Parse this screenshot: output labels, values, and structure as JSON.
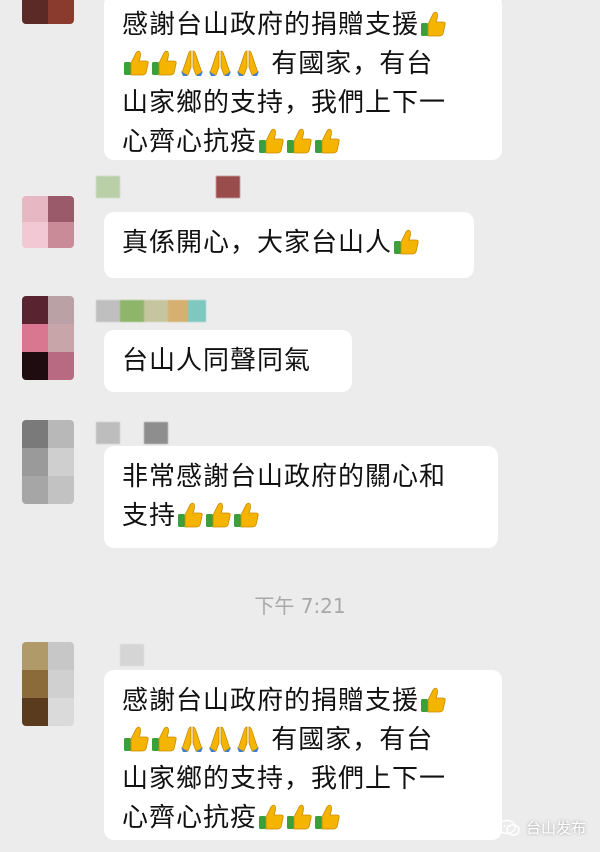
{
  "messages": [
    {
      "id": "m1",
      "text_lines": [
        "感謝台山政府的捐贈支援",
        "👍",
        "👍👍🙏🙏🙏 有國家，有台",
        "山家鄉的支持，我們上下一",
        "心齊心抗疫👍👍👍"
      ]
    },
    {
      "id": "m2",
      "text": "真係開心，大家台山人"
    },
    {
      "id": "m3",
      "text": "台山人同聲同氣"
    },
    {
      "id": "m4",
      "line1": "非常感謝台山政府的關心和",
      "line2": "支持"
    },
    {
      "id": "m5",
      "text_lines": [
        "感謝台山政府的捐贈支援",
        "有國家，有台",
        "山家鄉的支持，我們上下一",
        "心齊心抗疫"
      ]
    }
  ],
  "m1": {
    "l1": "感謝台山政府的捐贈支援",
    "l2": "有國家，有台",
    "l3": "山家鄉的支持，我們上下一",
    "l4": "心齊心抗疫"
  },
  "m2": {
    "l1": "真係開心，大家台山人"
  },
  "m3": {
    "l1": "台山人同聲同氣"
  },
  "m4": {
    "l1": "非常感謝台山政府的關心和",
    "l2": "支持"
  },
  "m5": {
    "l1": "感謝台山政府的捐贈支援",
    "l2": "有國家，有台",
    "l3": "山家鄉的支持，我們上下一",
    "l4": "心齊心抗疫"
  },
  "timestamp": "下午 7:21",
  "watermark": {
    "label": "台山发布",
    "icon": "wechat-icon"
  },
  "icons": {
    "thumbs_up": "thumbs-up-icon",
    "pray": "pray-icon"
  },
  "colors": {
    "background": "#ececec",
    "bubble": "#ffffff",
    "timestamp": "#a8a8a8",
    "thumb": "#f4b400",
    "cuff": "#3aa03a"
  }
}
